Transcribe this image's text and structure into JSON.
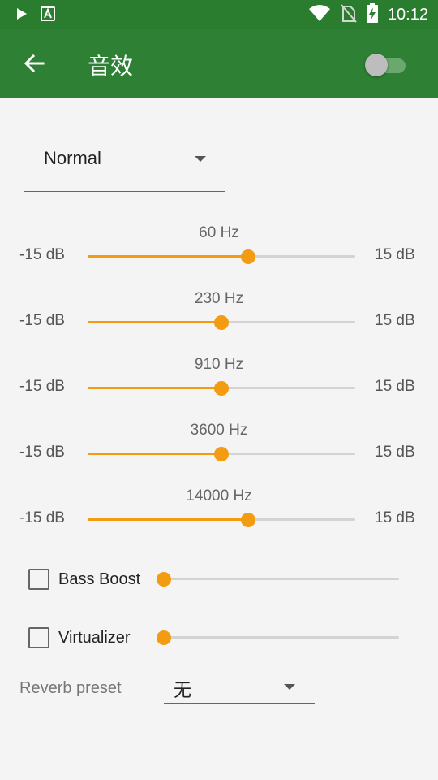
{
  "status_bar": {
    "time": "10:12",
    "icons": [
      "play-icon",
      "font-a-icon",
      "wifi-icon",
      "no-sim-icon",
      "battery-charging-icon"
    ]
  },
  "header": {
    "title": "音效",
    "back_icon": "arrow-back-icon",
    "enabled": false
  },
  "preset": {
    "selected": "Normal"
  },
  "bands": [
    {
      "freq": "60 Hz",
      "min": "-15 dB",
      "max": "15 dB",
      "level": 0.6
    },
    {
      "freq": "230 Hz",
      "min": "-15 dB",
      "max": "15 dB",
      "level": 0.5
    },
    {
      "freq": "910 Hz",
      "min": "-15 dB",
      "max": "15 dB",
      "level": 0.5
    },
    {
      "freq": "3600 Hz",
      "min": "-15 dB",
      "max": "15 dB",
      "level": 0.5
    },
    {
      "freq": "14000 Hz",
      "min": "-15 dB",
      "max": "15 dB",
      "level": 0.6
    }
  ],
  "effects": {
    "bass_boost": {
      "label": "Bass Boost",
      "checked": false,
      "level": 0
    },
    "virtualizer": {
      "label": "Virtualizer",
      "checked": false,
      "level": 0
    }
  },
  "reverb": {
    "label": "Reverb preset",
    "selected": "无"
  },
  "colors": {
    "primary": "#2e8034",
    "status_bar": "#2a7d2e",
    "accent": "#f39c12",
    "background": "#f4f4f4"
  }
}
